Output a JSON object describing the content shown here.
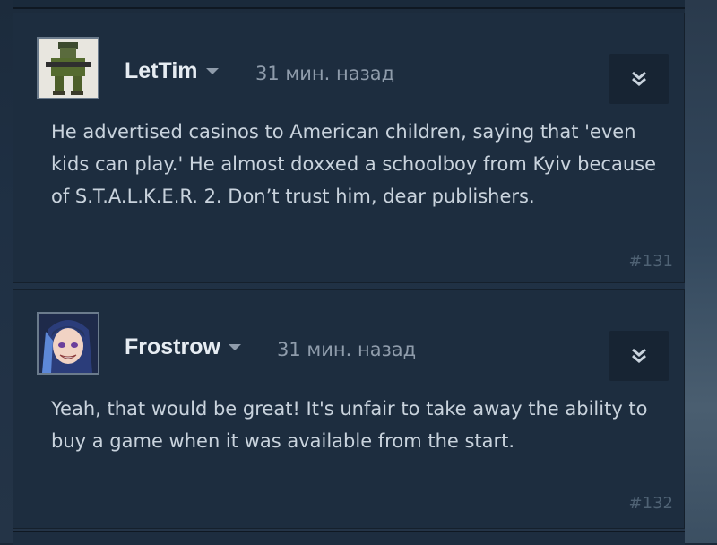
{
  "comments": [
    {
      "author": "LetTim",
      "time": "31 мин. назад",
      "text": "He advertised casinos to American children, saying that 'even kids can play.' He almost doxxed a schoolboy from Kyiv because of S.T.A.L.K.E.R. 2. Don’t trust him, dear publishers.",
      "number": "#131",
      "avatar_icon": "soldier-avatar-icon",
      "expand_icon": "double-chevron-down-icon"
    },
    {
      "author": "Frostrow",
      "time": "31 мин. назад",
      "text": "Yeah, that would be great! It's unfair to take away the ability to buy a game when it was available from the start.",
      "number": "#132",
      "avatar_icon": "anime-girl-avatar-icon",
      "expand_icon": "double-chevron-down-icon"
    }
  ],
  "colors": {
    "background": "#1b2838",
    "panel": "#1d2d3f",
    "author": "#e6ecf2",
    "text": "#c9d3dd",
    "muted": "#8f9cab"
  }
}
